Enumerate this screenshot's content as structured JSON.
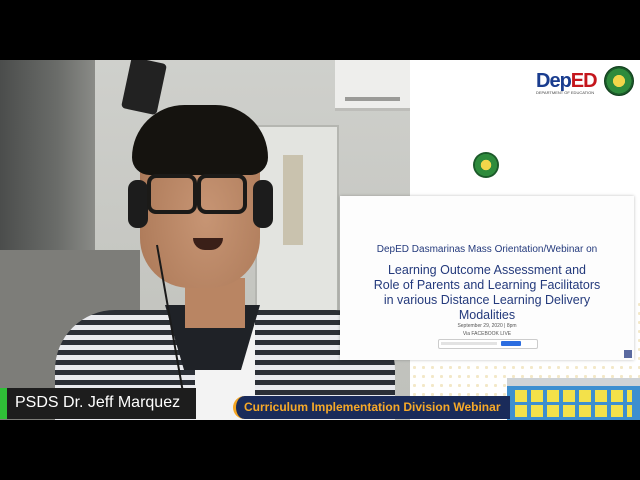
{
  "brand": {
    "logo_dep": "Dep",
    "logo_ed": "ED",
    "logo_sub": "DEPARTMENT OF EDUCATION",
    "seal_icon": "deped-seal-icon"
  },
  "slide": {
    "organizer": "DepED Dasmarinas Mass Orientation/Webinar on",
    "title_line1": "Learning Outcome Assessment and",
    "title_line2": "Role of Parents and Learning Facilitators",
    "title_line3": "in various Distance Learning Delivery",
    "title_line4": "Modalities",
    "date": "September 29, 2020 | 8pm",
    "via": "Via FACEBOOK LIVE"
  },
  "lower_third": {
    "speaker_name": "PSDS Dr. Jeff Marquez",
    "webinar_label": "Curriculum Implementation Division Webinar"
  },
  "colors": {
    "name_accent": "#2fbf37",
    "webinar_bg": "#1a2b5a",
    "webinar_text": "#f7a928",
    "slide_text": "#243a7c"
  }
}
